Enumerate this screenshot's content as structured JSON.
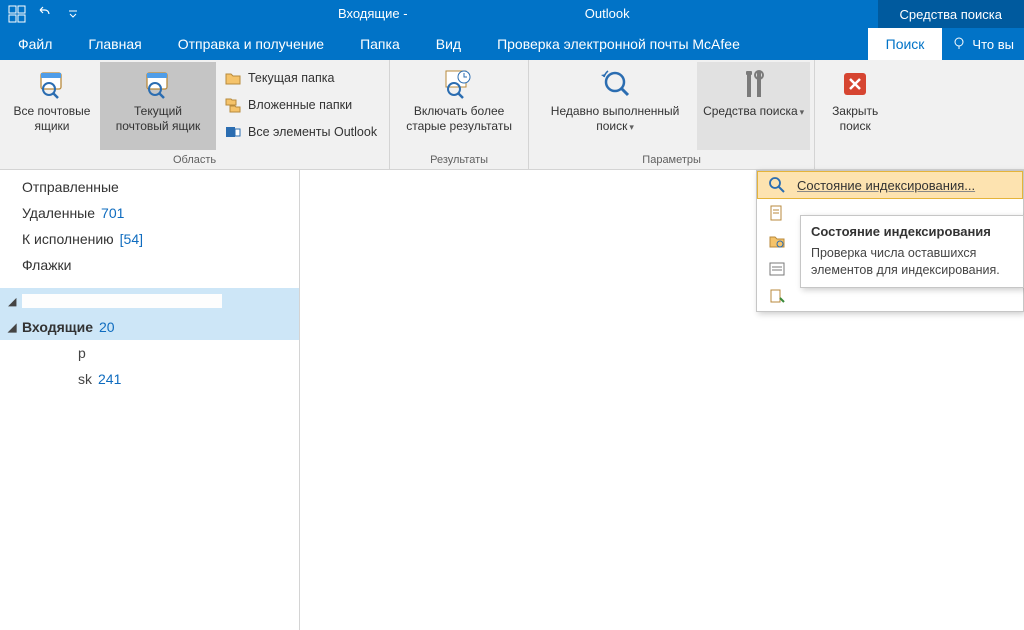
{
  "title": {
    "prefix": "Входящие -",
    "suffix": "Outlook"
  },
  "tools_context_tab": "Средства поиска",
  "tabs": {
    "file": "Файл",
    "home": "Главная",
    "sendreceive": "Отправка и получение",
    "folder": "Папка",
    "view": "Вид",
    "mcafee": "Проверка электронной почты McAfee",
    "search": "Поиск",
    "tellme": "Что вы"
  },
  "ribbon": {
    "scope": {
      "label": "Область",
      "all_mailboxes": "Все почтовые ящики",
      "current_mailbox": "Текущий почтовый ящик",
      "current_folder": "Текущая папка",
      "subfolders": "Вложенные папки",
      "all_outlook": "Все элементы Outlook"
    },
    "results": {
      "label": "Результаты",
      "older": "Включать более старые результаты"
    },
    "options": {
      "label": "Параметры",
      "recent": "Недавно выполненный поиск",
      "tools": "Средства поиска"
    },
    "close": {
      "close": "Закрыть поиск"
    }
  },
  "nav": {
    "sent": "Отправленные",
    "deleted": "Удаленные",
    "deleted_count": "701",
    "followup": "К исполнению",
    "followup_count": "[54]",
    "flags": "Флажки",
    "inbox": "Входящие",
    "inbox_count": "20",
    "sub_p": "p",
    "sub_sk": "sk",
    "sub_sk_count": "241"
  },
  "dropdown": {
    "indexing_status": "Состояние индексирования..."
  },
  "tooltip": {
    "title": "Состояние индексирования",
    "body": "Проверка числа оставшихся элементов для индексирования."
  }
}
